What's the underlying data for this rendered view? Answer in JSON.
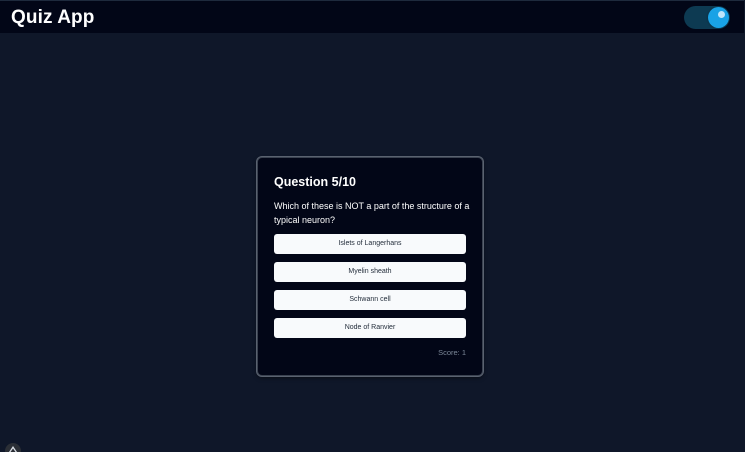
{
  "header": {
    "title": "Quiz App",
    "theme_toggle": {
      "state": "on",
      "accent": "#19a2e6",
      "icon": "moon-icon"
    }
  },
  "quiz": {
    "question_header": "Question 5/10",
    "question_text": "Which of these is NOT a part of the structure of a typical neuron?",
    "answers": [
      "Islets of Langerhans",
      "Myelin sheath",
      "Schwann cell",
      "Node of Ranvier"
    ],
    "score": "Score: 1"
  },
  "colors": {
    "page_bg": "#0f1729",
    "header_bg": "#020617",
    "card_bg": "#020617",
    "answer_bg": "#f8fafc"
  },
  "corner_icon": "logo-icon"
}
